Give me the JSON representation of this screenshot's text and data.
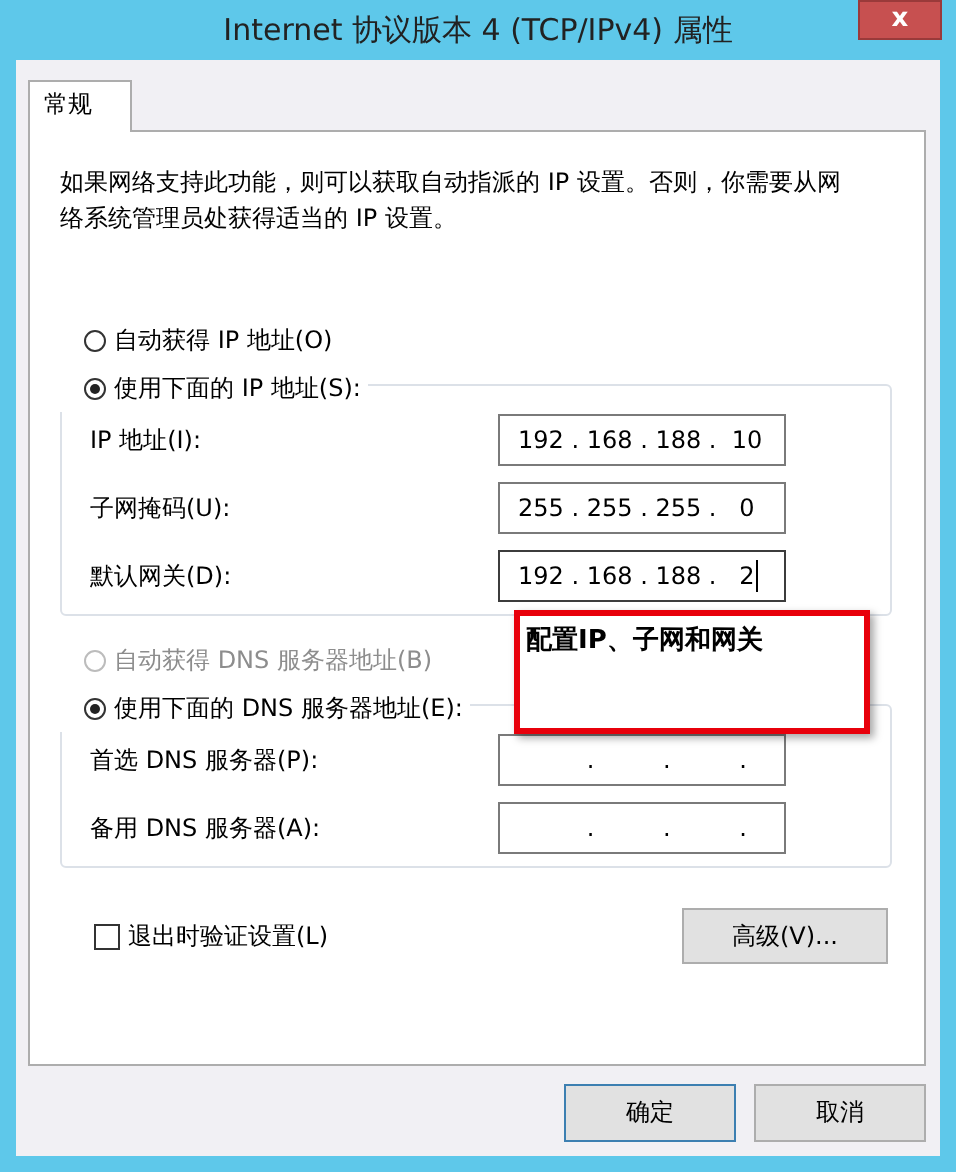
{
  "window": {
    "title": "Internet 协议版本 4 (TCP/IPv4) 属性",
    "close": "x"
  },
  "tabs": [
    {
      "label": "常规",
      "selected": true
    }
  ],
  "description": "如果网络支持此功能，则可以获取自动指派的 IP 设置。否则，你需要从网络系统管理员处获得适当的 IP 设置。",
  "ip_mode": [
    {
      "label": "自动获得 IP 地址(O)",
      "selected": false,
      "disabled": false
    },
    {
      "label": "使用下面的 IP 地址(S):",
      "selected": true,
      "disabled": false
    }
  ],
  "ip_fields": [
    {
      "label": "IP 地址(I):",
      "value": "192 . 168 . 188 .  10",
      "focused": false
    },
    {
      "label": "子网掩码(U):",
      "value": "255 . 255 . 255 .   0",
      "focused": false
    },
    {
      "label": "默认网关(D):",
      "value": "192 . 168 . 188 .   2",
      "focused": true
    }
  ],
  "dns_mode": [
    {
      "label": "自动获得 DNS 服务器地址(B)",
      "selected": false,
      "disabled": true
    },
    {
      "label": "使用下面的 DNS 服务器地址(E):",
      "selected": true,
      "disabled": false
    }
  ],
  "dns_fields": [
    {
      "label": "首选 DNS 服务器(P):",
      "value": "         .         .         .",
      "focused": false
    },
    {
      "label": "备用 DNS 服务器(A):",
      "value": "         .         .         .",
      "focused": false
    }
  ],
  "validate": {
    "label": "退出时验证设置(L)",
    "checked": false
  },
  "advanced_button": "高级(V)...",
  "callout": "配置IP、子网和网关",
  "buttons": [
    "确定",
    "取消"
  ]
}
